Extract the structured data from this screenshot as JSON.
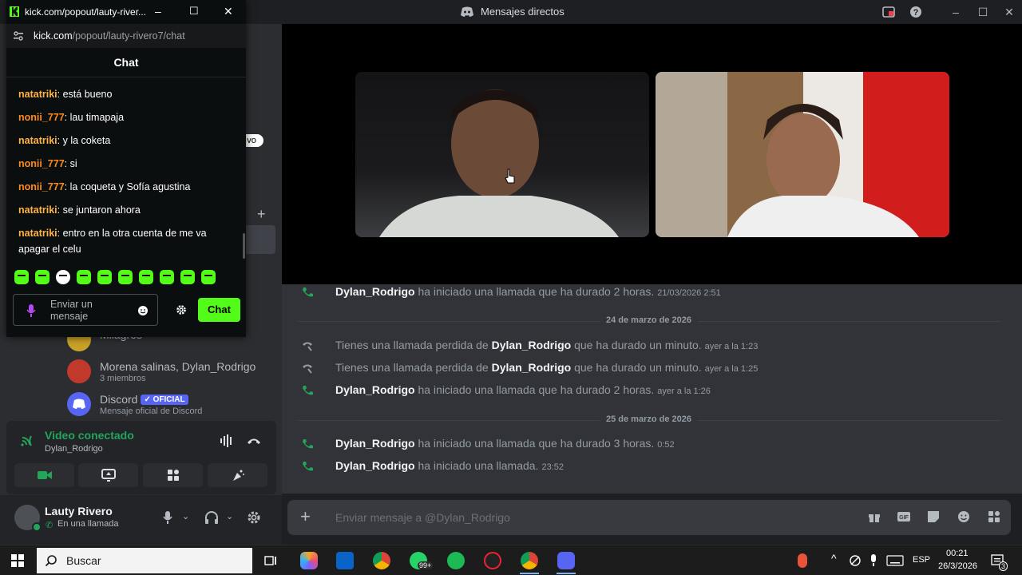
{
  "window": {
    "title": "Mensajes directos"
  },
  "sidebar": {
    "visible_badge_text": "vo",
    "dm_list": [
      {
        "name": "Milagros",
        "sub": ""
      },
      {
        "name": "Morena salinas, Dylan_Rodrigo",
        "sub": "3 miembros"
      },
      {
        "name": "Discord",
        "badge": "✓ OFICIAL",
        "sub": "Mensaje oficial de Discord"
      }
    ],
    "voice": {
      "status": "Video conectado",
      "user": "Dylan_Rodrigo"
    },
    "user": {
      "name": "Lauty Rivero",
      "status": "En una llamada"
    }
  },
  "messages": [
    {
      "user": "Dylan_Rodrigo",
      "text": " ha iniciado una llamada que ha durado 2 horas.",
      "time": "21/03/2026 2:51",
      "type": "call-start"
    },
    {
      "divider": "24 de marzo de 2026"
    },
    {
      "prefix": "Tienes una llamada perdida de ",
      "user": "Dylan_Rodrigo",
      "text": " que ha durado un minuto.",
      "time": "ayer a la 1:23",
      "type": "missed"
    },
    {
      "prefix": "Tienes una llamada perdida de ",
      "user": "Dylan_Rodrigo",
      "text": " que ha durado un minuto.",
      "time": "ayer a la 1:25",
      "type": "missed"
    },
    {
      "user": "Dylan_Rodrigo",
      "text": " ha iniciado una llamada que ha durado 2 horas.",
      "time": "ayer a la 1:26",
      "type": "call-start"
    },
    {
      "divider": "25 de marzo de 2026"
    },
    {
      "user": "Dylan_Rodrigo",
      "text": " ha iniciado una llamada que ha durado 3 horas.",
      "time": "0:52",
      "type": "call-start"
    },
    {
      "user": "Dylan_Rodrigo",
      "text": " ha iniciado una llamada.",
      "time": "23:52",
      "type": "call-start"
    }
  ],
  "composer": {
    "placeholder": "Enviar mensaje a @Dylan_Rodrigo"
  },
  "kick": {
    "window_title": "kick.com/popout/lauty-river...",
    "url_host": "kick.com",
    "url_path": "/popout/lauty-rivero7/chat",
    "header": "Chat",
    "chat": [
      {
        "user": "natatriki",
        "color": "#ffb347",
        "text": "está bueno"
      },
      {
        "user": "nonii_777",
        "color": "#ff8c1a",
        "text": "lau timapaja"
      },
      {
        "user": "natatriki",
        "color": "#ffb347",
        "text": "y la coketa"
      },
      {
        "user": "nonii_777",
        "color": "#ff8c1a",
        "text": "si"
      },
      {
        "user": "nonii_777",
        "color": "#ff8c1a",
        "text": "la coqueta y Sofía agustina"
      },
      {
        "user": "natatriki",
        "color": "#ffb347",
        "text": "se juntaron ahora"
      },
      {
        "user": "natatriki",
        "color": "#ffb347",
        "text": "entro en la otra cuenta de me va apagar el celu"
      }
    ],
    "input_placeholder": "Enviar un mensaje",
    "send_label": "Chat"
  },
  "taskbar": {
    "search_label": "Buscar",
    "whatsapp_badge": "99+",
    "lang": "ESP",
    "time": "00:21",
    "date": "26/3/2026",
    "notif_count": "3"
  },
  "colors": {
    "kick_green": "#53fc18",
    "discord_green": "#23a55a",
    "blurple": "#5865f2"
  }
}
